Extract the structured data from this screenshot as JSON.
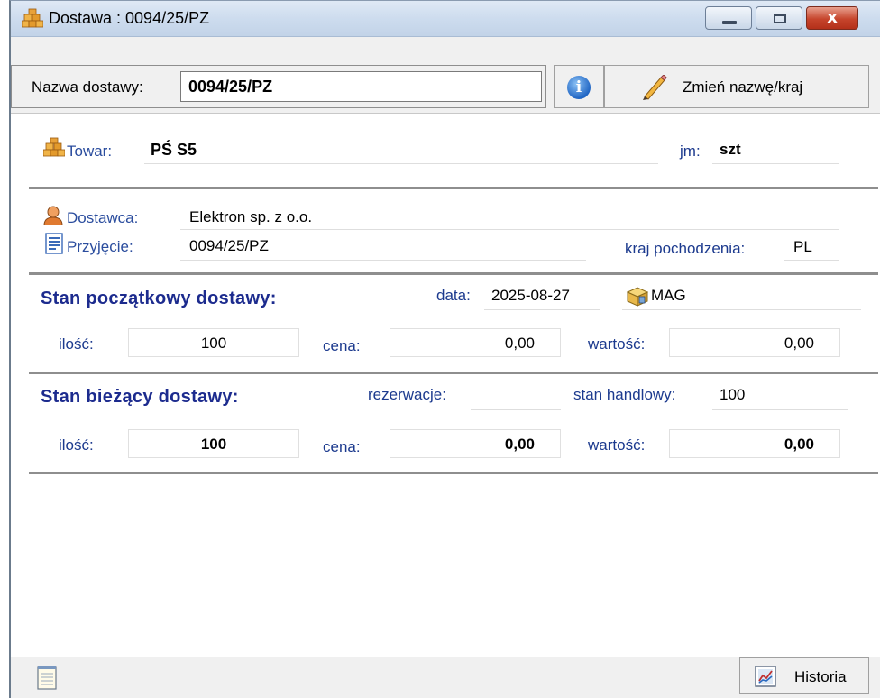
{
  "window": {
    "title": "Dostawa : 0094/25/PZ",
    "close_glyph": "x"
  },
  "toolbar": {
    "name_label": "Nazwa dostawy:",
    "name_value": "0094/25/PZ",
    "info_glyph": "i",
    "rename_label": "Zmień nazwę/kraj"
  },
  "product": {
    "towar_label": "Towar:",
    "towar_value": "PŚ S5",
    "jm_label": "jm:",
    "jm_value": "szt"
  },
  "supplier": {
    "dostawca_label": "Dostawca:",
    "dostawca_value": "Elektron sp. z o.o.",
    "przyjecie_label": "Przyjęcie:",
    "przyjecie_value": "0094/25/PZ",
    "kraj_label": "kraj pochodzenia:",
    "kraj_value": "PL"
  },
  "initial": {
    "heading": "Stan początkowy dostawy:",
    "data_label": "data:",
    "data_value": "2025-08-27",
    "magazyn": "MAG",
    "ilosc_label": "ilość:",
    "ilosc_value": "100",
    "cena_label": "cena:",
    "cena_value": "0,00",
    "wartosc_label": "wartość:",
    "wartosc_value": "0,00"
  },
  "current": {
    "heading": "Stan bieżący dostawy:",
    "rezerwacje_label": "rezerwacje:",
    "rezerwacje_value": "",
    "stan_label": "stan handlowy:",
    "stan_value": "100",
    "ilosc_label": "ilość:",
    "ilosc_value": "100",
    "cena_label": "cena:",
    "cena_value": "0,00",
    "wartosc_label": "wartość:",
    "wartosc_value": "0,00"
  },
  "status": {
    "historia_label": "Historia"
  },
  "colors": {
    "heading": "#1c2b8e",
    "link_label": "#2b4d9e",
    "close_button": "#c6452c"
  },
  "icons": [
    "boxes-icon",
    "info-icon",
    "pencil-icon",
    "person-icon",
    "document-icon",
    "warehouse-box-icon",
    "notepad-icon",
    "chart-icon"
  ]
}
